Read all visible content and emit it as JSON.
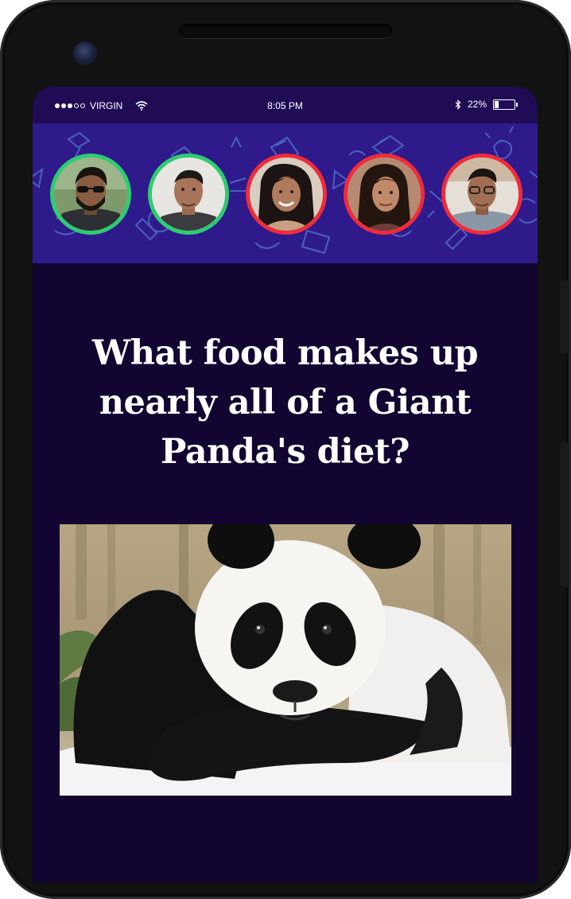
{
  "status_bar": {
    "carrier": "VIRGIN",
    "time": "8:05 PM",
    "battery": "22%",
    "battery_level": 0.22
  },
  "players": [
    {
      "name": "player-1",
      "status": "correct",
      "ring_color": "#2ecc71"
    },
    {
      "name": "player-2",
      "status": "correct",
      "ring_color": "#2ecc71"
    },
    {
      "name": "player-3",
      "status": "wrong",
      "ring_color": "#f02b3a"
    },
    {
      "name": "player-4",
      "status": "wrong",
      "ring_color": "#f02b3a"
    },
    {
      "name": "player-5",
      "status": "wrong",
      "ring_color": "#f02b3a"
    }
  ],
  "question": {
    "line1": "What food makes up",
    "line2": "nearly all of a Giant",
    "line3": "Panda's diet?"
  },
  "image": {
    "subject": "giant-panda"
  },
  "colors": {
    "header_bg": "#2f1a8c",
    "status_bg": "#1f0c55",
    "screen_bg": "#130532",
    "correct": "#2ecc71",
    "wrong": "#f02b3a"
  }
}
